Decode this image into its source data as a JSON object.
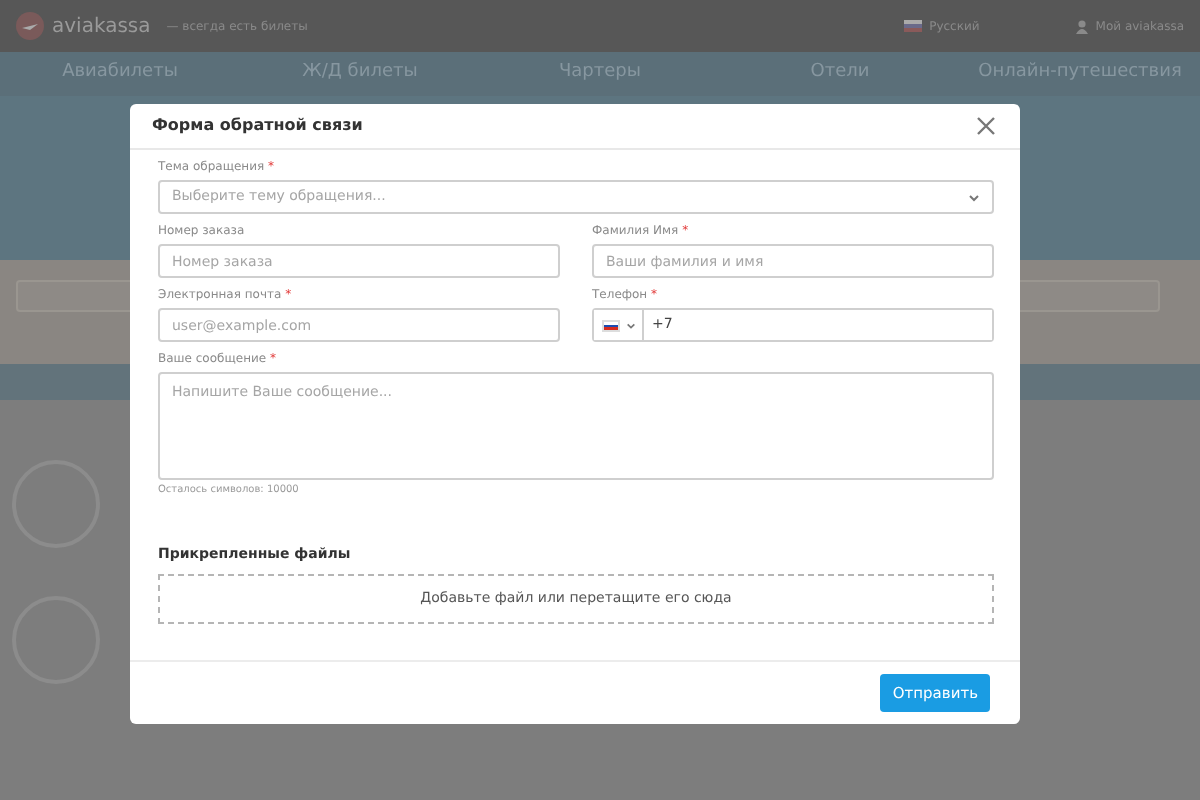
{
  "header": {
    "logo": "aviakassa",
    "tagline": "— всегда есть билеты",
    "language": "Русский",
    "account": "Мой aviakassa"
  },
  "nav": [
    "Авиабилеты",
    "Ж/Д билеты",
    "Чартеры",
    "Отели",
    "Онлайн-путешествия"
  ],
  "modal": {
    "title": "Форма обратной связи",
    "rows": [
      [
        {
          "kind": "select",
          "label": "Тема обращения",
          "required_mark": "*",
          "placeholder": "Выберите тему обращения..."
        }
      ],
      [
        {
          "kind": "text",
          "label": "Номер заказа",
          "placeholder": "Номер заказа"
        },
        {
          "kind": "text",
          "label": "Фамилия Имя",
          "required_mark": "*",
          "placeholder": "Ваши фамилия и имя"
        }
      ],
      [
        {
          "kind": "text",
          "label": "Электронная почта",
          "required_mark": "*",
          "placeholder": "user@example.com"
        },
        {
          "kind": "phone",
          "label": "Телефон",
          "required_mark": "*",
          "value": "+7"
        }
      ],
      [
        {
          "kind": "textarea",
          "label": "Ваше сообщение",
          "required_mark": "*",
          "placeholder": "Напишите Ваше сообщение...",
          "hint": "Осталось символов: 10000"
        }
      ]
    ],
    "attachments_title": "Прикрепленные файлы",
    "dropzone": "Добавьте файл или перетащите его сюда",
    "submit": "Отправить"
  }
}
